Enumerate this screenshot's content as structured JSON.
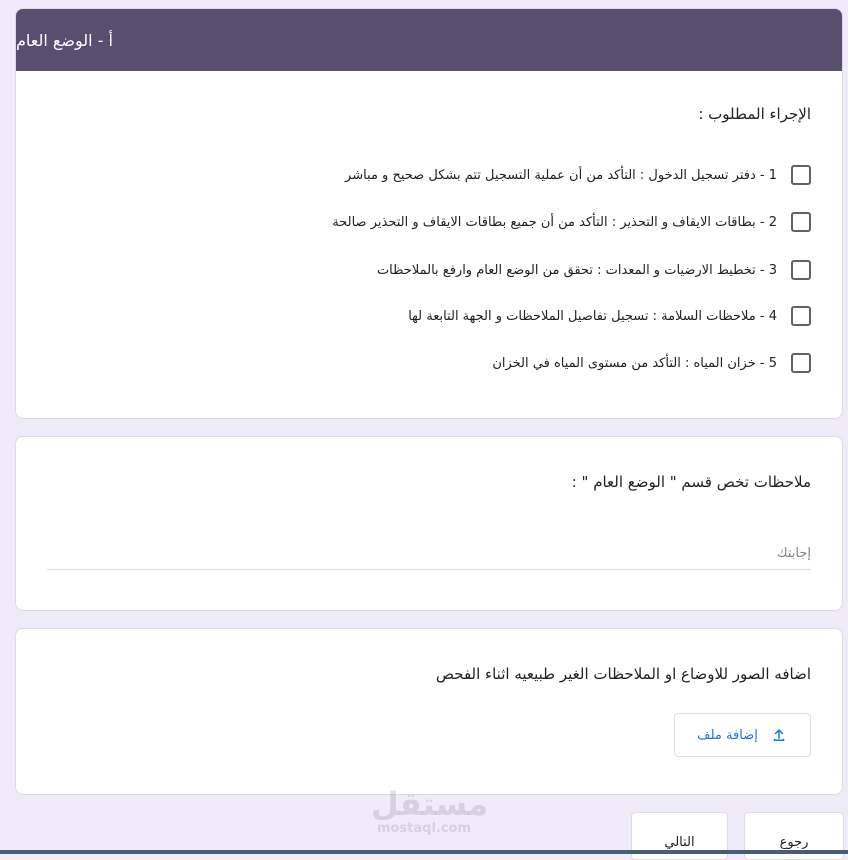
{
  "section": {
    "title": "أ - الوضع العام"
  },
  "question": {
    "title": "الإجراء المطلوب :",
    "options": [
      {
        "label": "1 - دفتر تسجيل الدخول : التأكد من أن عملية التسجيل تتم بشكل صحيح و مباشر"
      },
      {
        "label": "2 - بطاقات الايقاف و التحذير : التأكد من أن جميع بطاقات الايقاف و التحذير صالحة"
      },
      {
        "label": "3 - تخطيط الارضيات و المعدات : تحقق من الوضع العام وارفع بالملاحظات"
      },
      {
        "label": "4 - ملاحظات السلامة : تسجيل تفاصيل الملاحظات و الجهة التابعة لها"
      },
      {
        "label": "5 - خزان المياه : التأكد من مستوى المياه في الخزان"
      }
    ]
  },
  "notes": {
    "title": "ملاحظات تخص قسم \" الوضع العام \" :",
    "placeholder": "إجابتك"
  },
  "upload": {
    "title": "اضافه الصور للاوضاع او الملاحظات الغير طبيعيه اثناء الفحص",
    "button_label": "إضافة ملف",
    "icon": "upload-icon"
  },
  "navigation": {
    "back_label": "رجوع",
    "next_label": "التالي"
  },
  "watermark": {
    "arabic": "مستقل",
    "latin": "mostaql.com"
  },
  "colors": {
    "header": "#574e70",
    "background": "#f0ebf8",
    "accent": "#1a73e8"
  }
}
